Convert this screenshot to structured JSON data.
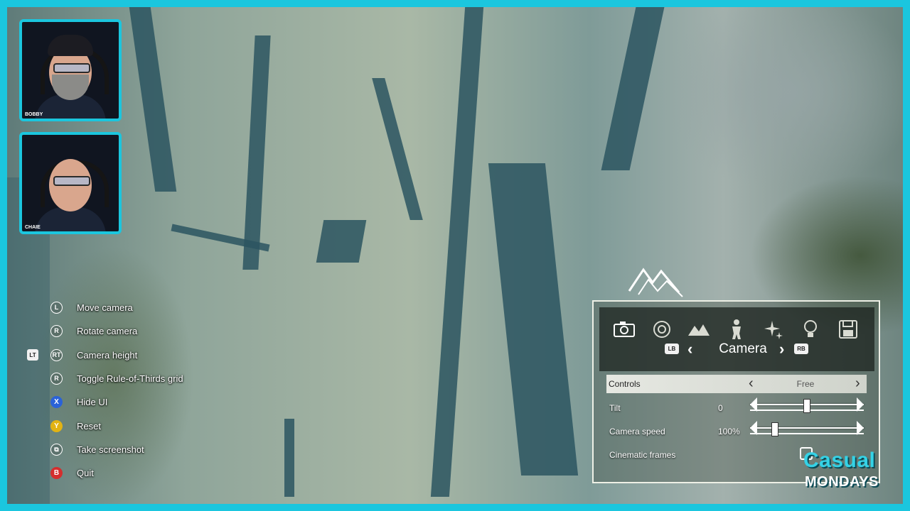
{
  "streamers": [
    {
      "name": "BOBBY"
    },
    {
      "name": "CHAIE"
    }
  ],
  "controls_hints": [
    {
      "button": "L",
      "style": "stick",
      "label": "Move camera"
    },
    {
      "button": "R",
      "style": "stick",
      "label": "Rotate camera"
    },
    {
      "button": "LT",
      "button2": "RT",
      "style": "trigger",
      "label": "Camera height"
    },
    {
      "button": "R",
      "style": "stick",
      "label": "Toggle Rule-of-Thirds grid"
    },
    {
      "button": "X",
      "style": "face",
      "color": "#2a62d8",
      "label": "Hide UI"
    },
    {
      "button": "Y",
      "style": "face",
      "color": "#e2b313",
      "label": "Reset"
    },
    {
      "button": "⧉",
      "style": "stick",
      "label": "Take screenshot"
    },
    {
      "button": "B",
      "style": "face",
      "color": "#d42e2e",
      "label": "Quit"
    }
  ],
  "photo_panel": {
    "tabs": [
      {
        "icon": "camera-icon",
        "active": true
      },
      {
        "icon": "target-icon",
        "active": false
      },
      {
        "icon": "mountains-icon",
        "active": false
      },
      {
        "icon": "character-icon",
        "active": false
      },
      {
        "icon": "sparkle-icon",
        "active": false
      },
      {
        "icon": "lightbulb-icon",
        "active": false
      },
      {
        "icon": "save-icon",
        "active": false
      }
    ],
    "lb": "LB",
    "rb": "RB",
    "title": "Camera",
    "rows": {
      "controls": {
        "label": "Controls",
        "value": "Free"
      },
      "tilt": {
        "label": "Tilt",
        "value": "0",
        "level": 0.5
      },
      "speed": {
        "label": "Camera speed",
        "value": "100%",
        "level": 0.15
      },
      "cinematic": {
        "label": "Cinematic frames",
        "checked": false
      }
    }
  },
  "branding": {
    "line1": "Casual",
    "line2": "MONDAYS"
  },
  "colors": {
    "frame": "#1bc6de",
    "brand_cyan": "#34d2e6"
  }
}
